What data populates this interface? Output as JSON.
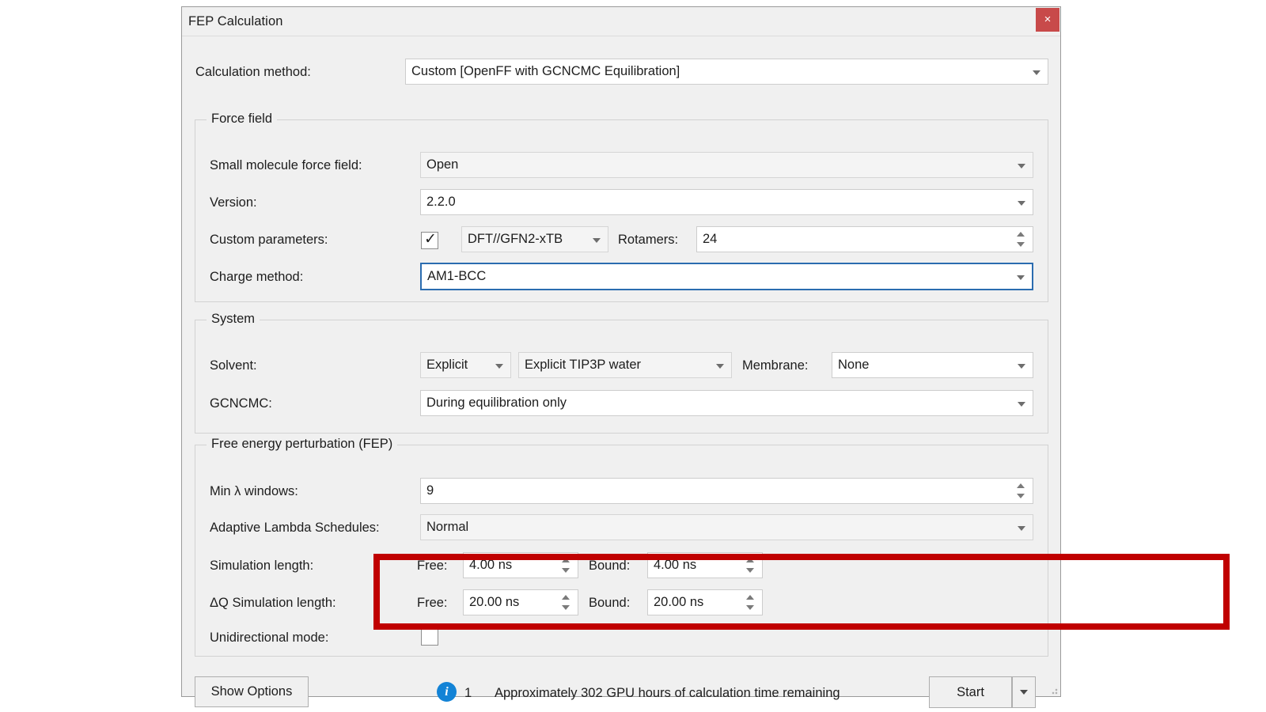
{
  "window": {
    "title": "FEP Calculation",
    "close_label": "×"
  },
  "top": {
    "calc_method_label": "Calculation method:",
    "calc_method_value": "Custom [OpenFF with GCNCMC Equilibration]"
  },
  "force_field": {
    "group_title": "Force field",
    "small_molecule_label": "Small molecule force field:",
    "small_molecule_value": "Open",
    "version_label": "Version:",
    "version_value": "2.2.0",
    "custom_params_label": "Custom parameters:",
    "custom_params_checked": true,
    "custom_params_value": "DFT//GFN2-xTB",
    "rotamers_label": "Rotamers:",
    "rotamers_value": "24",
    "charge_method_label": "Charge method:",
    "charge_method_value": "AM1-BCC"
  },
  "system": {
    "group_title": "System",
    "solvent_label": "Solvent:",
    "solvent_mode_value": "Explicit",
    "solvent_model_value": "Explicit TIP3P water",
    "membrane_label": "Membrane:",
    "membrane_value": "None",
    "gcncmc_label": "GCNCMC:",
    "gcncmc_value": "During equilibration only"
  },
  "fep": {
    "group_title": "Free energy perturbation (FEP)",
    "min_lambda_label": "Min λ windows:",
    "min_lambda_value": "9",
    "adaptive_label": "Adaptive Lambda Schedules:",
    "adaptive_value": "Normal",
    "sim_length_label": "Simulation length:",
    "sim_free_label": "Free:",
    "sim_free_value": "4.00 ns",
    "sim_bound_label": "Bound:",
    "sim_bound_value": "4.00 ns",
    "dq_sim_length_label": "ΔQ Simulation length:",
    "dq_free_label": "Free:",
    "dq_free_value": "20.00 ns",
    "dq_bound_label": "Bound:",
    "dq_bound_value": "20.00 ns",
    "unidirectional_label": "Unidirectional mode:",
    "unidirectional_checked": false
  },
  "footer": {
    "show_options_label": "Show Options",
    "info_icon_glyph": "i",
    "info_count": "1",
    "status_text": "Approximately 302 GPU hours of calculation time remaining",
    "start_label": "Start"
  },
  "colors": {
    "accent_focus": "#2b6cb0",
    "close_red": "#c84a4a",
    "annotation_red": "#c00000",
    "info_blue": "#1383d6",
    "dialog_bg": "#f0f0f0"
  }
}
